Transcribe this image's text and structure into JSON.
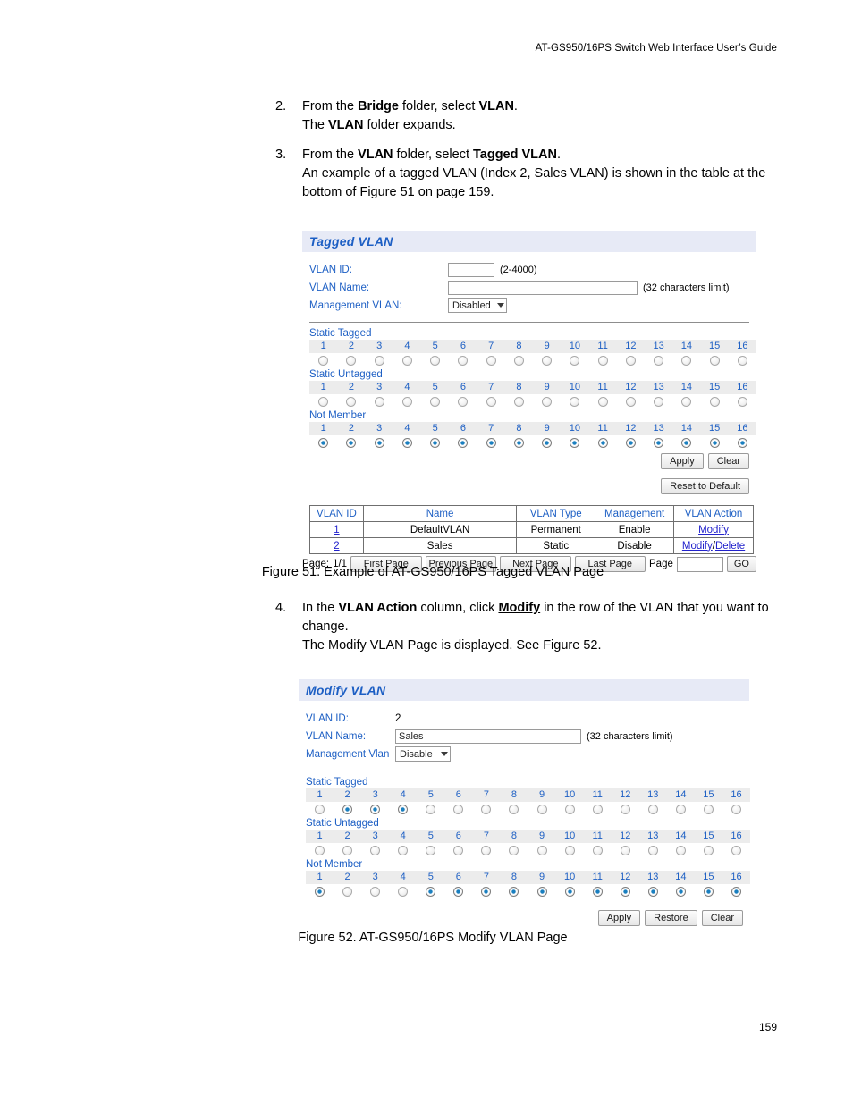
{
  "document": {
    "running_head": "AT-GS950/16PS Switch Web Interface User’s Guide",
    "page_number": "159"
  },
  "steps": [
    {
      "number": "2.",
      "lines": [
        "From the <b>Bridge</b> folder, select <b>VLAN</b>.",
        "The <b>VLAN</b> folder expands."
      ]
    },
    {
      "number": "3.",
      "lines": [
        "From the <b>VLAN</b> folder, select <b>Tagged VLAN</b>.",
        "An example of a tagged VLAN (Index 2, Sales VLAN) is shown in the table at the bottom of Figure 51 on page 159."
      ]
    },
    {
      "number": "4.",
      "lines": [
        "In the <b>VLAN Action</b> column, click <span class=\"ulink\">Modify</span> in the row of the VLAN that you want to change.",
        "The Modify VLAN Page is displayed. See Figure 52."
      ]
    }
  ],
  "captions": {
    "figure_51": "Figure 51. Example of AT-GS950/16PS Tagged VLAN Page",
    "figure_52": "Figure 52. AT-GS950/16PS Modify VLAN Page"
  },
  "tagged_vlan_panel": {
    "title": "Tagged VLAN",
    "fields": {
      "vlan_id_label": "VLAN ID:",
      "vlan_id_value": "",
      "vlan_id_hint": "(2-4000)",
      "vlan_name_label": "VLAN Name:",
      "vlan_name_value": "",
      "vlan_name_hint": "(32 characters limit)",
      "management_label": "Management VLAN:",
      "management_value": "Disabled"
    },
    "port_groups": [
      {
        "label": "Static Tagged",
        "ports": [
          "1",
          "2",
          "3",
          "4",
          "5",
          "6",
          "7",
          "8",
          "9",
          "10",
          "11",
          "12",
          "13",
          "14",
          "15",
          "16"
        ],
        "selected": []
      },
      {
        "label": "Static Untagged",
        "ports": [
          "1",
          "2",
          "3",
          "4",
          "5",
          "6",
          "7",
          "8",
          "9",
          "10",
          "11",
          "12",
          "13",
          "14",
          "15",
          "16"
        ],
        "selected": []
      },
      {
        "label": "Not Member",
        "ports": [
          "1",
          "2",
          "3",
          "4",
          "5",
          "6",
          "7",
          "8",
          "9",
          "10",
          "11",
          "12",
          "13",
          "14",
          "15",
          "16"
        ],
        "selected": [
          1,
          2,
          3,
          4,
          5,
          6,
          7,
          8,
          9,
          10,
          11,
          12,
          13,
          14,
          15,
          16
        ]
      }
    ],
    "buttons": {
      "apply": "Apply",
      "clear": "Clear",
      "reset": "Reset to Default"
    },
    "table": {
      "headers": [
        "VLAN ID",
        "Name",
        "VLAN Type",
        "Management",
        "VLAN Action"
      ],
      "rows": [
        {
          "vlan_id": "1",
          "name": "DefaultVLAN",
          "vlan_type": "Permanent",
          "management": "Enable",
          "actions": [
            "Modify"
          ]
        },
        {
          "vlan_id": "2",
          "name": "Sales",
          "vlan_type": "Static",
          "management": "Disable",
          "actions": [
            "Modify",
            "Delete"
          ]
        }
      ]
    },
    "pager": {
      "page_status_label": "Page:",
      "page_status_value": "1/1",
      "first": "First Page",
      "previous": "Previous Page",
      "next": "Next Page",
      "last": "Last Page",
      "page_label": "Page",
      "page_value": "",
      "go": "GO"
    }
  },
  "modify_vlan_panel": {
    "title": "Modify VLAN",
    "fields": {
      "vlan_id_label": "VLAN ID:",
      "vlan_id_value": "2",
      "vlan_name_label": "VLAN Name:",
      "vlan_name_value": "Sales",
      "vlan_name_hint": "(32 characters limit)",
      "management_label": "Management Vlan",
      "management_value": "Disable"
    },
    "port_groups": [
      {
        "label": "Static Tagged",
        "ports": [
          "1",
          "2",
          "3",
          "4",
          "5",
          "6",
          "7",
          "8",
          "9",
          "10",
          "11",
          "12",
          "13",
          "14",
          "15",
          "16"
        ],
        "selected": [
          2,
          3,
          4
        ]
      },
      {
        "label": "Static Untagged",
        "ports": [
          "1",
          "2",
          "3",
          "4",
          "5",
          "6",
          "7",
          "8",
          "9",
          "10",
          "11",
          "12",
          "13",
          "14",
          "15",
          "16"
        ],
        "selected": []
      },
      {
        "label": "Not Member",
        "ports": [
          "1",
          "2",
          "3",
          "4",
          "5",
          "6",
          "7",
          "8",
          "9",
          "10",
          "11",
          "12",
          "13",
          "14",
          "15",
          "16"
        ],
        "selected": [
          1,
          5,
          6,
          7,
          8,
          9,
          10,
          11,
          12,
          13,
          14,
          15,
          16
        ]
      }
    ],
    "buttons": {
      "apply": "Apply",
      "restore": "Restore",
      "clear": "Clear"
    }
  },
  "colors": {
    "panel_header_bg": "#e7eaf6",
    "accent_blue": "#1d5fc4",
    "link_blue": "#2222cc",
    "port_band_bg": "#ececec",
    "radio_on": "#1a7fbf"
  }
}
